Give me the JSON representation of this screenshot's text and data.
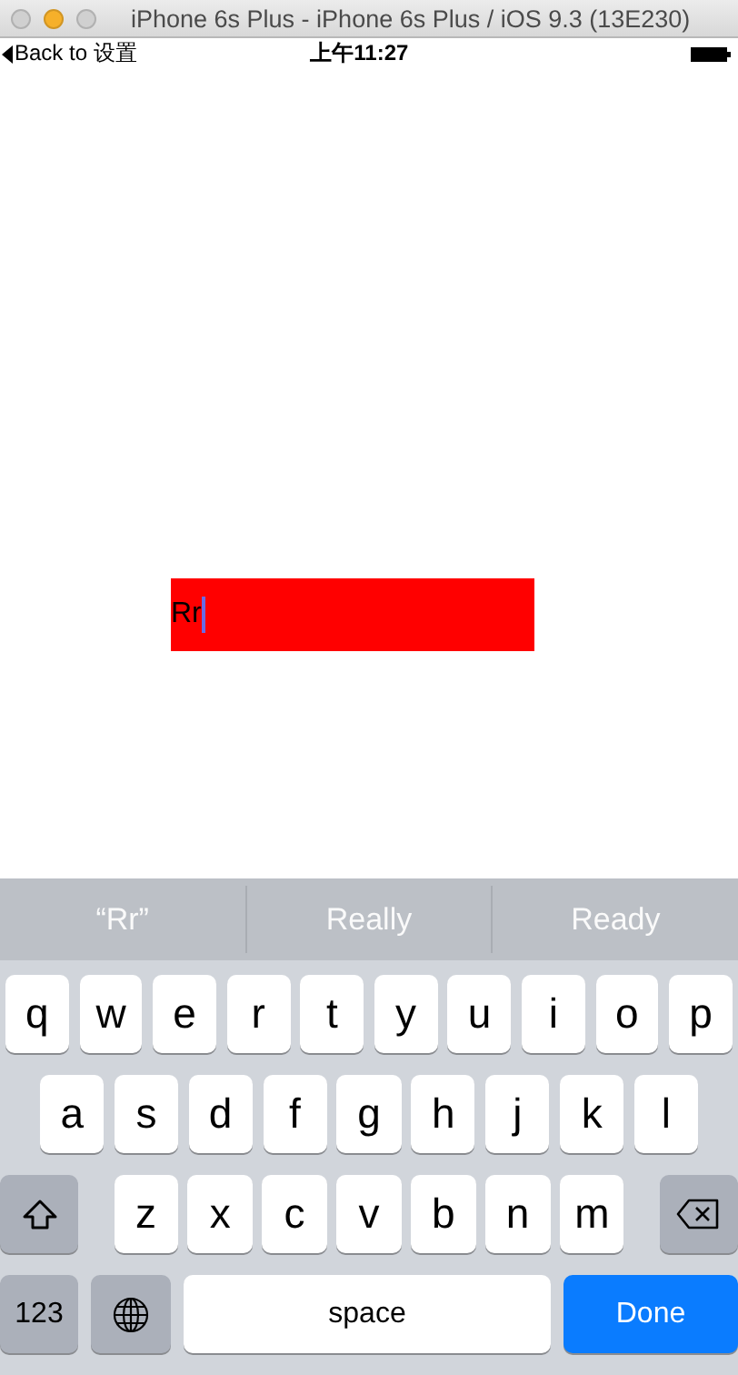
{
  "window": {
    "title": "iPhone 6s Plus - iPhone 6s Plus / iOS 9.3 (13E230)"
  },
  "status_bar": {
    "back_label": "Back to 设置",
    "time": "上午11:27"
  },
  "text_field": {
    "value": "Rr",
    "focused": true
  },
  "suggestions": [
    {
      "label": "“Rr”"
    },
    {
      "label": "Really"
    },
    {
      "label": "Ready"
    }
  ],
  "keyboard": {
    "letter_rows": [
      {
        "letters": [
          "q",
          "w",
          "e",
          "r",
          "t",
          "y",
          "u",
          "i",
          "o",
          "p"
        ]
      },
      {
        "letters": [
          "a",
          "s",
          "d",
          "f",
          "g",
          "h",
          "j",
          "k",
          "l"
        ]
      },
      {
        "letters": [
          "z",
          "x",
          "c",
          "v",
          "b",
          "n",
          "m"
        ]
      }
    ],
    "bottom_row": {
      "numbers_key": "123",
      "space_key": "space",
      "return_key": "Done"
    }
  }
}
